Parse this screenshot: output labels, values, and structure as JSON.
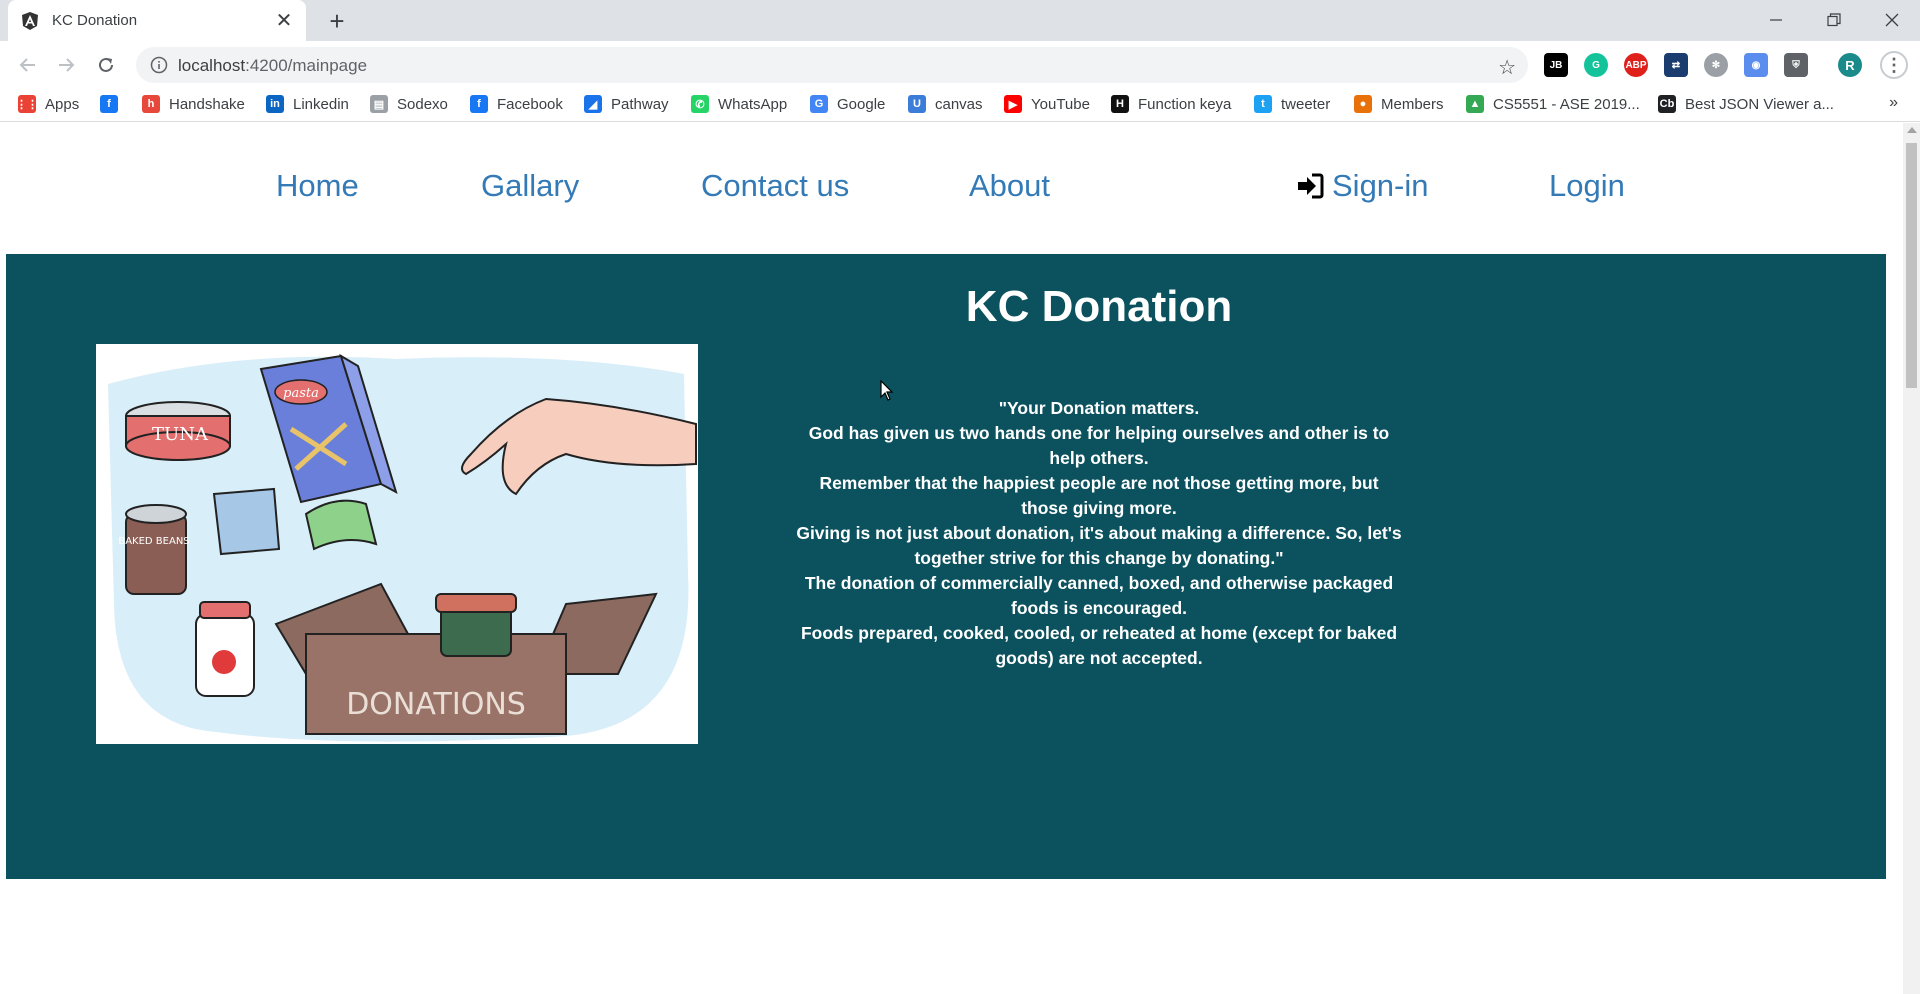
{
  "browser": {
    "tab_title": "KC Donation",
    "url_host": "localhost",
    "url_path": ":4200/mainpage",
    "profile_initial": "R"
  },
  "bookmarks": [
    {
      "label": "Apps",
      "icon": "apps-grid-icon",
      "color": "#ea4335"
    },
    {
      "label": "",
      "icon": "facebook-icon",
      "color": "#1877f2"
    },
    {
      "label": "Handshake",
      "icon": "handshake-icon",
      "color": "#e8473c"
    },
    {
      "label": "Linkedin",
      "icon": "linkedin-icon",
      "color": "#0a66c2"
    },
    {
      "label": "Sodexo",
      "icon": "sodexo-icon",
      "color": "#9aa0a6"
    },
    {
      "label": "Facebook",
      "icon": "facebook-icon",
      "color": "#1877f2"
    },
    {
      "label": "Pathway",
      "icon": "pathway-icon",
      "color": "#1a73e8"
    },
    {
      "label": "WhatsApp",
      "icon": "whatsapp-icon",
      "color": "#25d366"
    },
    {
      "label": "Google",
      "icon": "google-icon",
      "color": "#4285f4"
    },
    {
      "label": "canvas",
      "icon": "umkc-icon",
      "color": "#3c7dd9"
    },
    {
      "label": "YouTube",
      "icon": "youtube-icon",
      "color": "#ff0000"
    },
    {
      "label": "Function keya",
      "icon": "htg-icon",
      "color": "#111111"
    },
    {
      "label": "tweeter",
      "icon": "twitter-icon",
      "color": "#1da1f2"
    },
    {
      "label": "Members",
      "icon": "members-icon",
      "color": "#e8710a"
    },
    {
      "label": "CS5551 - ASE 2019...",
      "icon": "google-drive-icon",
      "color": "#34a853"
    },
    {
      "label": "Best JSON Viewer a...",
      "icon": "cb-icon",
      "color": "#202124"
    }
  ],
  "nav": {
    "home": "Home",
    "gallery": "Gallary",
    "contact": "Contact us",
    "about": "About",
    "signin": "Sign-in",
    "login": "Login"
  },
  "hero": {
    "title": "KC Donation",
    "quote_lines": [
      "\"Your Donation matters.",
      "God has given us two hands one for helping ourselves and other is to help others.",
      "Remember that the happiest people are not those getting more, but those giving more.",
      "Giving is not just about donation, it's about making a difference. So, let's together strive for this change by donating.\""
    ],
    "info_lines": [
      "The donation of commercially canned, boxed, and otherwise packaged foods is encouraged.",
      "Foods prepared, cooked, cooled, or reheated at home (except for baked goods) are not accepted."
    ],
    "image_labels": {
      "tuna": "TUNA",
      "pasta": "pasta",
      "beans": "BAKED BEANS",
      "box": "DONATIONS"
    },
    "bg_color": "#0b525e",
    "link_color": "#337ab7"
  }
}
